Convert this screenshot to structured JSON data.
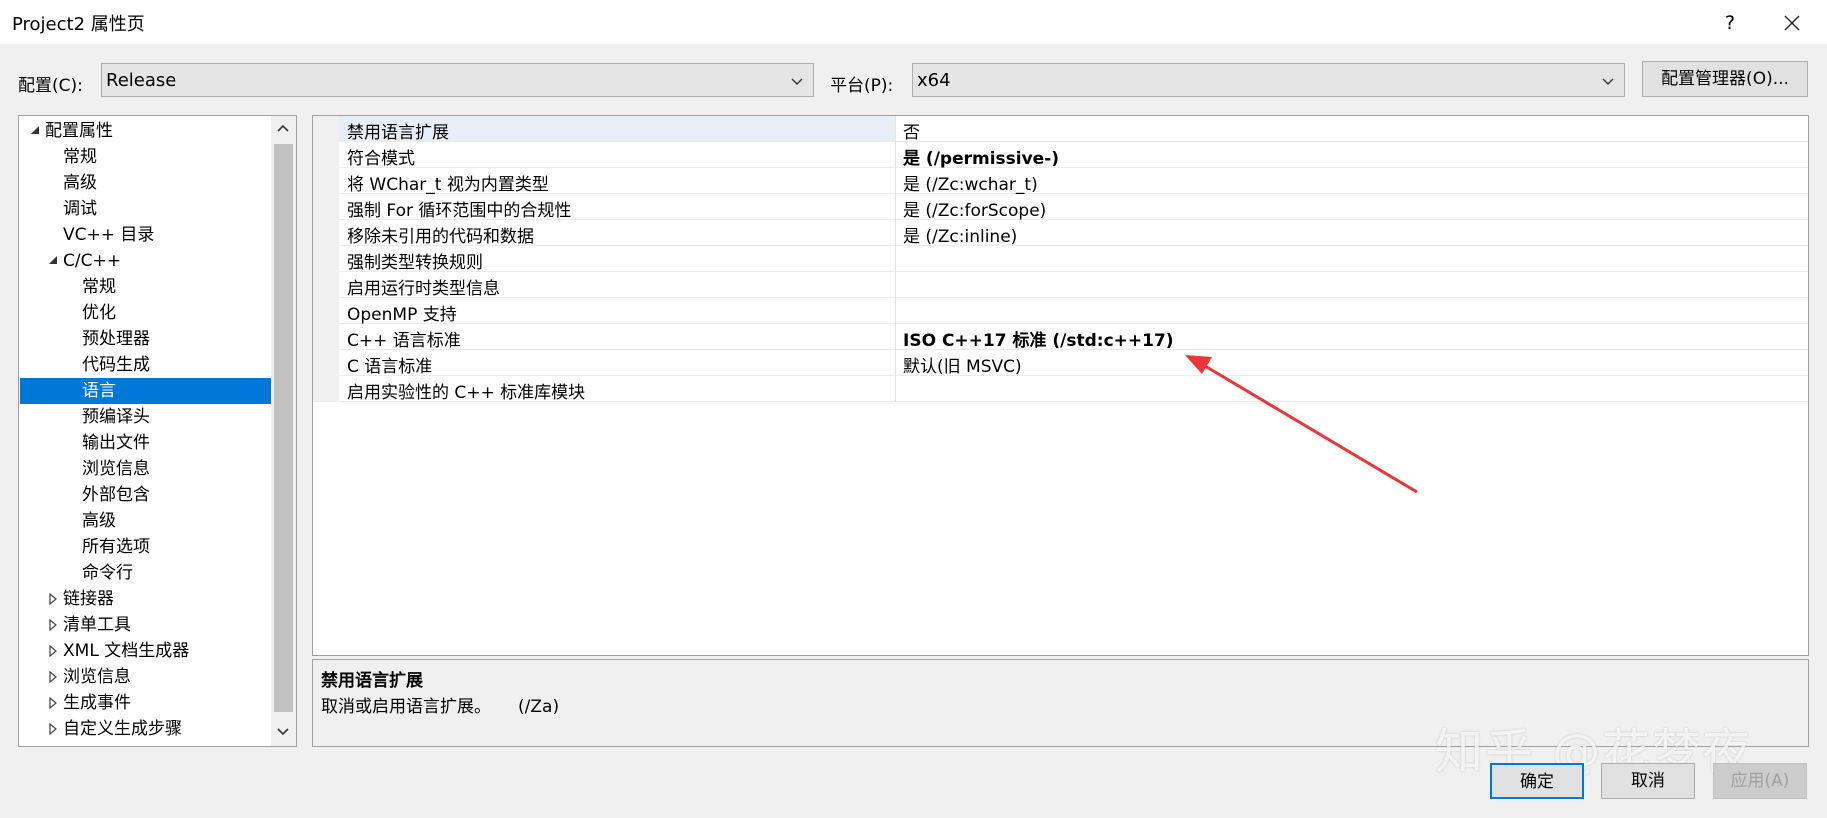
{
  "window": {
    "title": "Project2 属性页",
    "help_label": "?"
  },
  "config_bar": {
    "config_label": "配置(C):",
    "config_value": "Release",
    "platform_label": "平台(P):",
    "platform_value": "x64",
    "manager_button": "配置管理器(O)..."
  },
  "tree": {
    "items": [
      {
        "label": "配置属性",
        "expander": "expanded"
      },
      {
        "label": "常规"
      },
      {
        "label": "高级"
      },
      {
        "label": "调试"
      },
      {
        "label": "VC++ 目录"
      },
      {
        "label": "C/C++",
        "expander": "expanded"
      },
      {
        "label": "常规"
      },
      {
        "label": "优化"
      },
      {
        "label": "预处理器"
      },
      {
        "label": "代码生成"
      },
      {
        "label": "语言",
        "selected": true
      },
      {
        "label": "预编译头"
      },
      {
        "label": "输出文件"
      },
      {
        "label": "浏览信息"
      },
      {
        "label": "外部包含"
      },
      {
        "label": "高级"
      },
      {
        "label": "所有选项"
      },
      {
        "label": "命令行"
      },
      {
        "label": "链接器",
        "expander": "collapsed"
      },
      {
        "label": "清单工具",
        "expander": "collapsed"
      },
      {
        "label": "XML 文档生成器",
        "expander": "collapsed"
      },
      {
        "label": "浏览信息",
        "expander": "collapsed"
      },
      {
        "label": "生成事件",
        "expander": "collapsed"
      },
      {
        "label": "自定义生成步骤",
        "expander": "collapsed"
      }
    ]
  },
  "properties": [
    {
      "name": "禁用语言扩展",
      "value": "否",
      "bold": false
    },
    {
      "name": "符合模式",
      "value": "是 (/permissive-)",
      "bold": true
    },
    {
      "name": "将 WChar_t 视为内置类型",
      "value": "是 (/Zc:wchar_t)",
      "bold": false
    },
    {
      "name": "强制 For 循环范围中的合规性",
      "value": "是 (/Zc:forScope)",
      "bold": false
    },
    {
      "name": "移除未引用的代码和数据",
      "value": "是 (/Zc:inline)",
      "bold": false
    },
    {
      "name": "强制类型转换规则",
      "value": "",
      "bold": false
    },
    {
      "name": "启用运行时类型信息",
      "value": "",
      "bold": false
    },
    {
      "name": "OpenMP 支持",
      "value": "",
      "bold": false
    },
    {
      "name": "C++ 语言标准",
      "value": "ISO C++17 标准 (/std:c++17)",
      "bold": true
    },
    {
      "name": "C 语言标准",
      "value": "默认(旧 MSVC)",
      "bold": false
    },
    {
      "name": "启用实验性的 C++ 标准库模块",
      "value": "",
      "bold": false
    }
  ],
  "description": {
    "title": "禁用语言扩展",
    "text": "取消或启用语言扩展。     (/Za)"
  },
  "buttons": {
    "ok": "确定",
    "cancel": "取消",
    "apply": "应用(A)"
  },
  "watermark": "知乎 @花梦夜",
  "colors": {
    "selection": "#0078d7",
    "annotation_arrow": "#e8363b"
  }
}
